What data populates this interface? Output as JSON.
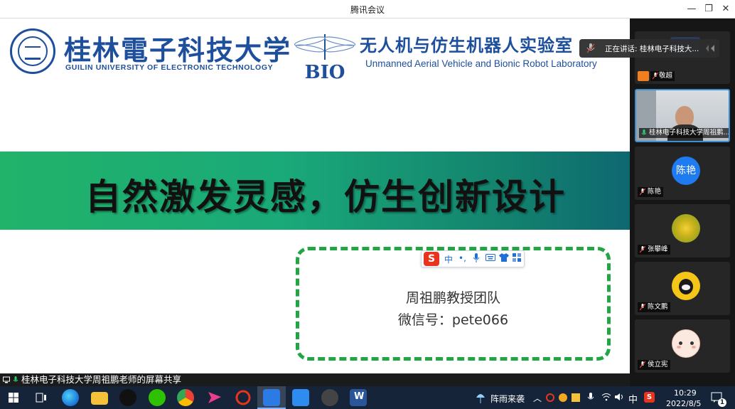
{
  "window": {
    "title": "腾讯会议"
  },
  "slide": {
    "university_cn": "桂林電子科技大学",
    "university_en": "GUILIN UNIVERSITY OF ELECTRONIC TECHNOLOGY",
    "bio_logo": "BIO",
    "lab_cn": "无人机与仿生机器人实验室",
    "lab_en": "Unmanned Aerial Vehicle and Bionic Robot Laboratory",
    "banner": "自然激发灵感，仿生创新设计",
    "team_name": "周祖鹏教授团队",
    "wechat": "微信号：pete066",
    "ime": {
      "logo": "S",
      "mode": "中",
      "punct": "•,"
    }
  },
  "share_label": "桂林电子科技大学周祖鹏老师的屏幕共享",
  "speaker": {
    "text": "正在讲话: 桂林电子科技大..."
  },
  "participants": [
    {
      "name": "敬超"
    },
    {
      "name": "桂林电子科技大学周祖鹏..."
    },
    {
      "name": "陈艳",
      "avatar_text": "陈艳",
      "color": "#1f7bf0"
    },
    {
      "name": "张攀峰"
    },
    {
      "name": "陈文鹏"
    },
    {
      "name": "侯立宪"
    }
  ],
  "taskbar": {
    "weather": "阵雨来袭",
    "ime": "中",
    "time": "10:29",
    "date": "2022/8/5",
    "notifications": "1"
  },
  "colors": {
    "brand_blue": "#1d4f9c",
    "banner_green": "#21b36a",
    "dashed_green": "#22a645"
  }
}
